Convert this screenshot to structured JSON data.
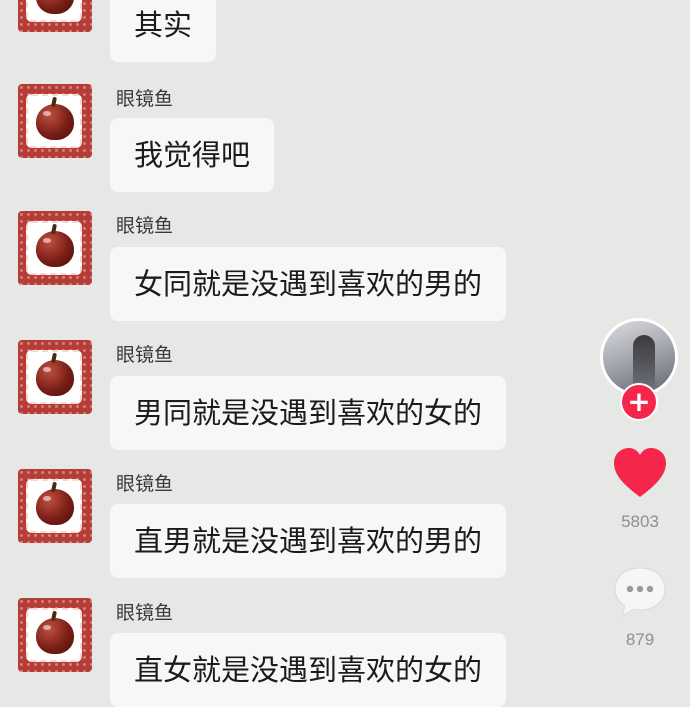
{
  "messages": [
    {
      "sender": "",
      "text": "其实"
    },
    {
      "sender": "眼镜鱼",
      "text": "我觉得吧"
    },
    {
      "sender": "眼镜鱼",
      "text": "女同就是没遇到喜欢的男的"
    },
    {
      "sender": "眼镜鱼",
      "text": "男同就是没遇到喜欢的女的"
    },
    {
      "sender": "眼镜鱼",
      "text": "直男就是没遇到喜欢的男的"
    },
    {
      "sender": "眼镜鱼",
      "text": "直女就是没遇到喜欢的女的"
    }
  ],
  "sidebar": {
    "follow_label": "+",
    "likes_count": "5803",
    "comments_count": "879"
  },
  "colors": {
    "background": "#e6e8e5",
    "bubble": "#f7f8f6",
    "avatar_red": "#b63c37",
    "like_heart": "#f4264c",
    "follow_button": "#f4264c",
    "counter_text": "#8e908d"
  },
  "icons": {
    "avatar": "apple-avatar-icon",
    "like": "heart-icon",
    "comment": "comment-bubble-icon",
    "follow": "plus-icon"
  }
}
